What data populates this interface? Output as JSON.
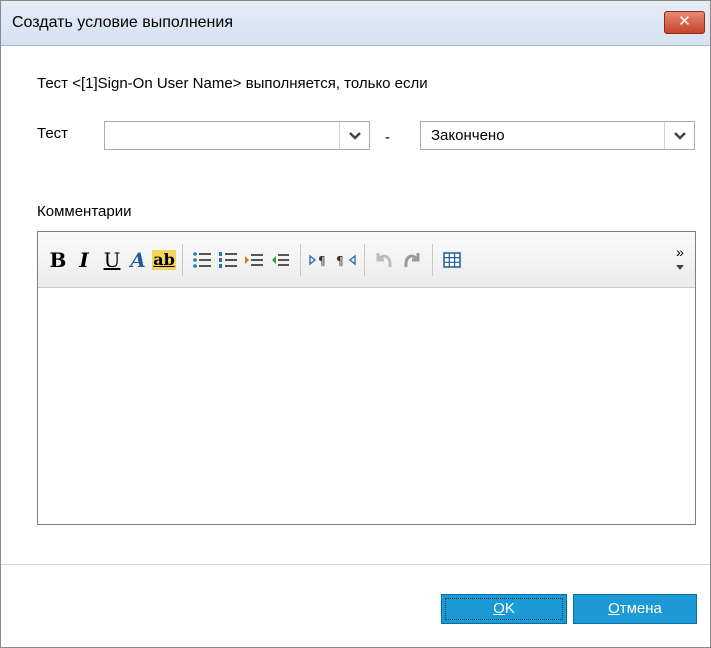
{
  "window": {
    "title": "Создать условие выполнения",
    "close_label": "✕"
  },
  "form": {
    "description": "Тест <[1]Sign-On User Name> выполняется, только если",
    "test_label": "Тест",
    "test_value": "",
    "separator": "-",
    "status_value": "Закончено",
    "comments_label": "Комментарии"
  },
  "toolbar": {
    "bold": "B",
    "italic": "I",
    "underline": "U",
    "font_color": "A",
    "highlight": "ab",
    "more": "»"
  },
  "editor": {
    "text": ""
  },
  "buttons": {
    "ok_mnemonic": "О",
    "ok_rest": "K",
    "cancel_mnemonic": "О",
    "cancel_rest": "тмена"
  },
  "colors": {
    "accent": "#1c9ad6",
    "close": "#c7432a"
  }
}
